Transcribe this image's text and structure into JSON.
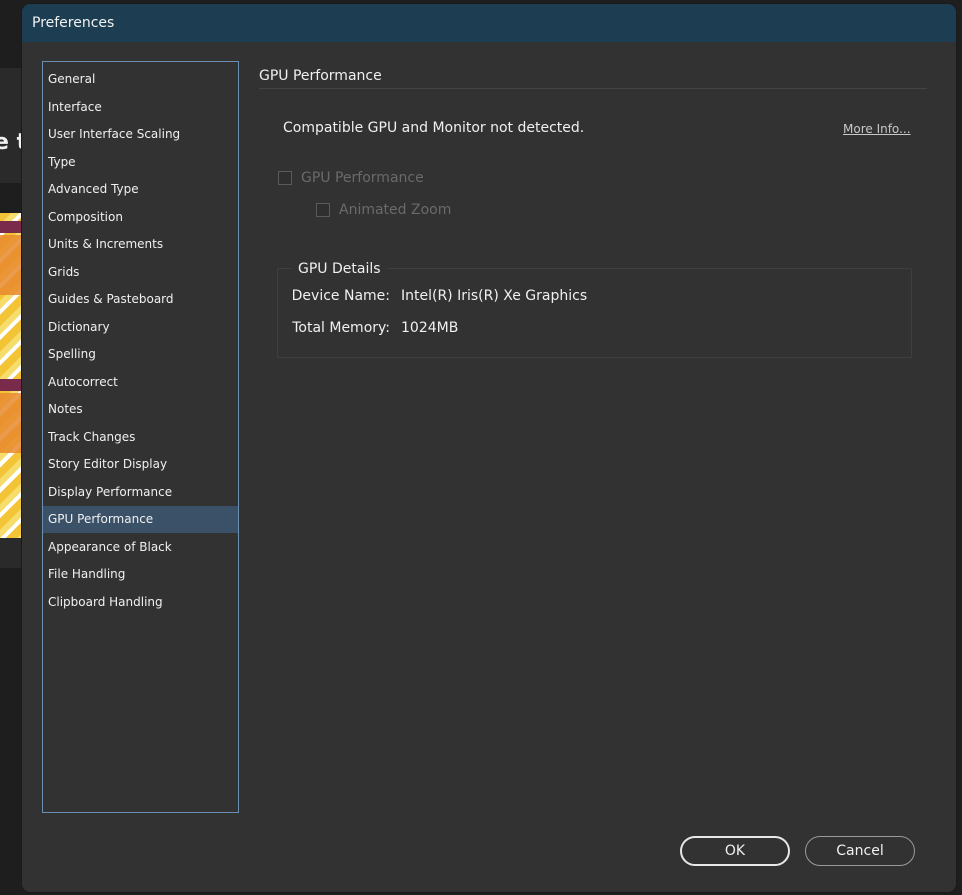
{
  "background": {
    "peek_text": "e to"
  },
  "dialog": {
    "title": "Preferences"
  },
  "sidebar": {
    "items": [
      {
        "label": "General"
      },
      {
        "label": "Interface"
      },
      {
        "label": "User Interface Scaling"
      },
      {
        "label": "Type"
      },
      {
        "label": "Advanced Type"
      },
      {
        "label": "Composition"
      },
      {
        "label": "Units & Increments"
      },
      {
        "label": "Grids"
      },
      {
        "label": "Guides & Pasteboard"
      },
      {
        "label": "Dictionary"
      },
      {
        "label": "Spelling"
      },
      {
        "label": "Autocorrect"
      },
      {
        "label": "Notes"
      },
      {
        "label": "Track Changes"
      },
      {
        "label": "Story Editor Display"
      },
      {
        "label": "Display Performance"
      },
      {
        "label": "GPU Performance",
        "selected": true
      },
      {
        "label": "Appearance of Black"
      },
      {
        "label": "File Handling"
      },
      {
        "label": "Clipboard Handling"
      }
    ]
  },
  "panel": {
    "title": "GPU Performance",
    "notice": "Compatible GPU and Monitor not detected.",
    "more_info": "More Info...",
    "gpu_performance_checkbox": {
      "label": "GPU Performance",
      "checked": false,
      "enabled": false
    },
    "animated_zoom_checkbox": {
      "label": "Animated Zoom",
      "checked": false,
      "enabled": false
    },
    "details": {
      "title": "GPU Details",
      "device_name_label": "Device Name:",
      "device_name_value": "Intel(R) Iris(R) Xe Graphics",
      "total_memory_label": "Total Memory:",
      "total_memory_value": "1024MB"
    }
  },
  "buttons": {
    "ok": "OK",
    "cancel": "Cancel"
  },
  "colors": {
    "titlebar": "#1c3d52",
    "dialog_bg": "#323232",
    "selection": "#3a5168",
    "sidebar_border": "#6a8fb0"
  }
}
